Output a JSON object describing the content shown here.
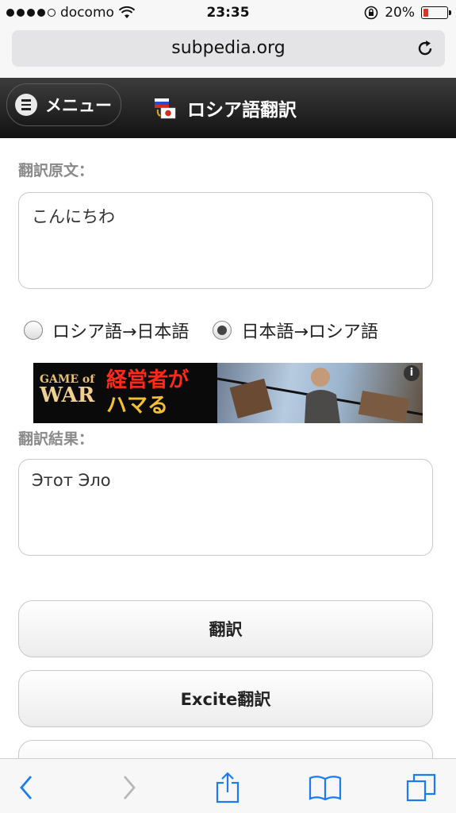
{
  "status_bar": {
    "carrier": "docomo",
    "time": "23:35",
    "battery": "20%",
    "battery_level": 0.2
  },
  "browser": {
    "url": "subpedia.org"
  },
  "header": {
    "menu_label": "メニュー",
    "title": "ロシア語翻訳"
  },
  "source": {
    "label": "翻訳原文：",
    "text": "こんにちわ"
  },
  "direction": {
    "options": [
      {
        "label": "ロシア語→日本語",
        "checked": false
      },
      {
        "label": "日本語→ロシア語",
        "checked": true
      }
    ]
  },
  "ad": {
    "brand_line1": "GAME of",
    "brand_line2": "WAR",
    "copy_line1": "経営者が",
    "copy_line2": "ハマる",
    "info": "i"
  },
  "result": {
    "label": "翻訳結果：",
    "text": "Этот Эло"
  },
  "buttons": {
    "translate": "翻訳",
    "excite": "Excite翻訳"
  },
  "colors": {
    "header_bg": "#1e1e1e",
    "battery_low": "#e0302a",
    "ios_blue": "#1a7cf5"
  }
}
